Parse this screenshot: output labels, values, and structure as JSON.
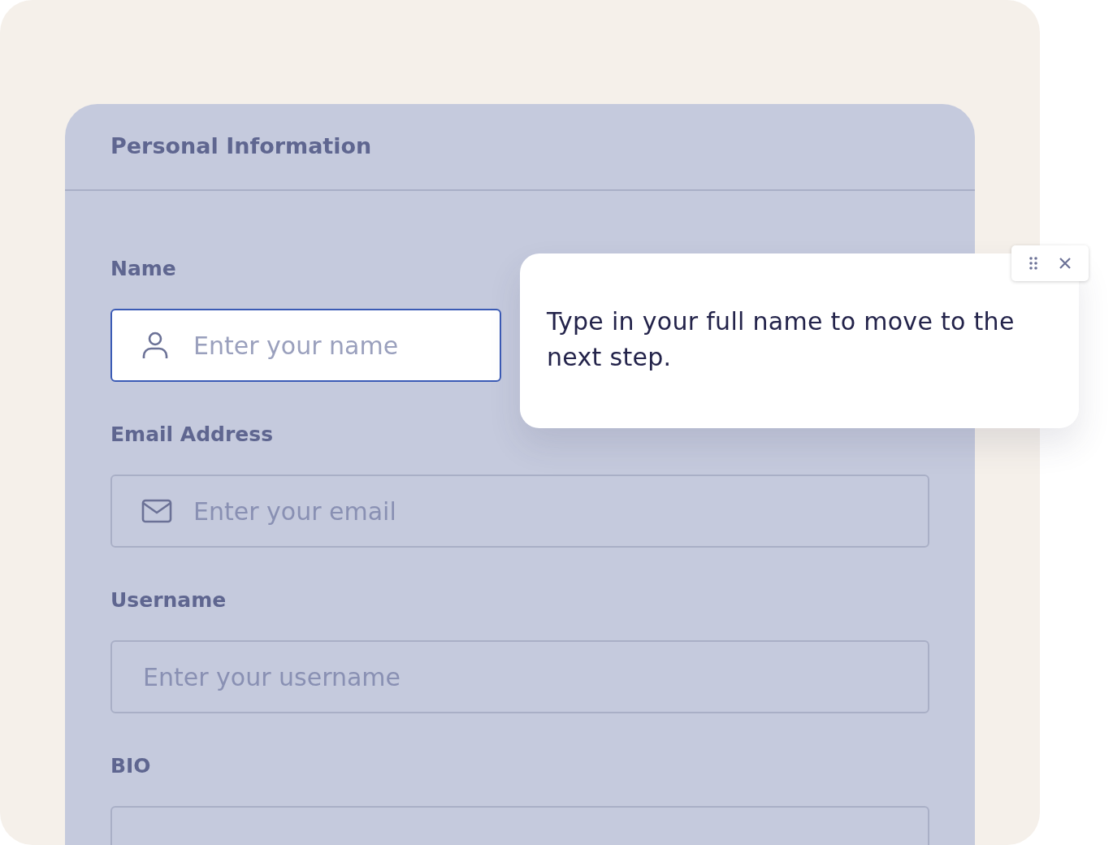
{
  "form": {
    "title": "Personal Information",
    "fields": [
      {
        "label": "Name",
        "placeholder": "Enter your name",
        "kind": "person",
        "focused": true
      },
      {
        "label": "Email Address",
        "placeholder": "Enter your email",
        "kind": "email",
        "focused": false
      },
      {
        "label": "Username",
        "placeholder": "Enter your username",
        "kind": "text",
        "focused": false
      },
      {
        "label": "BIO",
        "kind": "text",
        "focused": false
      }
    ]
  },
  "tooltip": {
    "text": "Type in your full name to move to the next step."
  }
}
